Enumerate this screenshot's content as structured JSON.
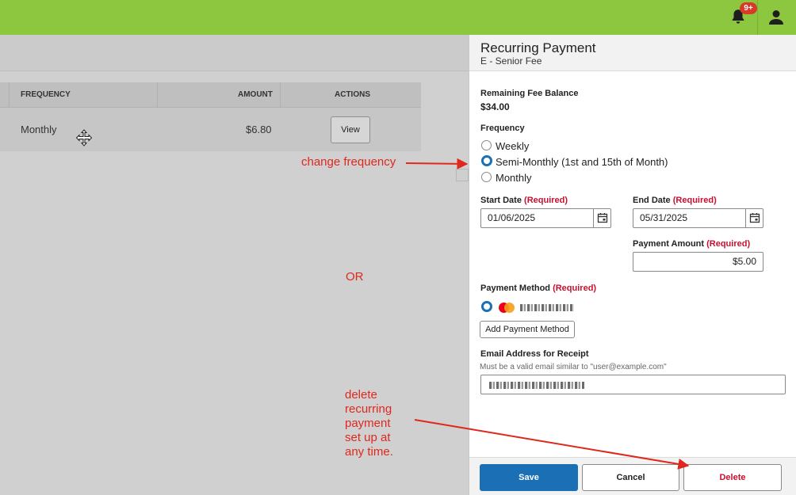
{
  "topbar": {
    "notification_badge": "9+",
    "bell_icon": "bell-icon",
    "user_icon": "user-icon",
    "color": "#8dc63f"
  },
  "table": {
    "headers": {
      "frequency": "FREQUENCY",
      "amount": "AMOUNT",
      "actions": "ACTIONS"
    },
    "row": {
      "frequency": "Monthly",
      "amount": "$6.80",
      "action_label": "View"
    }
  },
  "annotations": {
    "change_frequency": "change frequency",
    "or": "OR",
    "delete_lines": [
      "delete",
      "recurring",
      "payment",
      "set up at",
      "any time."
    ],
    "color": "#e0271d"
  },
  "panel": {
    "title": "Recurring Payment",
    "subtitle": "E - Senior Fee",
    "remaining_label": "Remaining Fee Balance",
    "remaining_value": "$34.00",
    "frequency_label": "Frequency",
    "frequency_options": [
      "Weekly",
      "Semi-Monthly (1st and 15th of Month)",
      "Monthly"
    ],
    "frequency_selected": "Semi-Monthly (1st and 15th of Month)",
    "required_text": "(Required)",
    "start_date_label": "Start Date",
    "start_date_value": "01/06/2025",
    "end_date_label": "End Date",
    "end_date_value": "05/31/2025",
    "payment_amount_label": "Payment Amount",
    "payment_amount_value": "$5.00",
    "payment_method_label": "Payment Method",
    "add_payment_method": "Add Payment Method",
    "email_label": "Email Address for Receipt",
    "email_hint": "Must be a valid email similar to \"user@example.com\"",
    "save_label": "Save",
    "cancel_label": "Cancel",
    "delete_label": "Delete",
    "accent_color": "#1a6fb5",
    "required_color": "#c8102e"
  }
}
